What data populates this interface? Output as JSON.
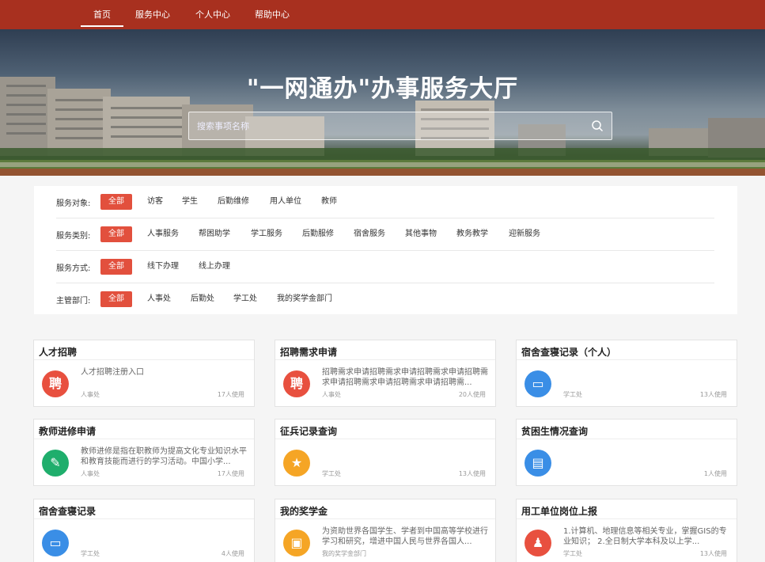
{
  "nav": [
    "首页",
    "服务中心",
    "个人中心",
    "帮助中心"
  ],
  "banner": {
    "title": "\"一网通办\"办事服务大厅",
    "search_placeholder": "搜索事项名称"
  },
  "filters": [
    {
      "label": "服务对象:",
      "options": [
        "全部",
        "访客",
        "学生",
        "后勤维修",
        "用人单位",
        "教师"
      ]
    },
    {
      "label": "服务类别:",
      "options": [
        "全部",
        "人事服务",
        "帮困助学",
        "学工服务",
        "后勤服修",
        "宿舍服务",
        "其他事物",
        "教务教学",
        "迎新服务"
      ]
    },
    {
      "label": "服务方式:",
      "options": [
        "全部",
        "线下办理",
        "线上办理"
      ]
    },
    {
      "label": "主管部门:",
      "options": [
        "全部",
        "人事处",
        "后勤处",
        "学工处",
        "我的奖学金部门"
      ]
    }
  ],
  "cards": [
    {
      "title": "人才招聘",
      "icon": "聘",
      "icon_name": "recruit-icon",
      "color": "red",
      "desc": "人才招聘注册入口",
      "dept": "人事处",
      "usage": "17人使用"
    },
    {
      "title": "招聘需求申请",
      "icon": "聘",
      "icon_name": "recruit-icon",
      "color": "red",
      "desc": "招聘需求申请招聘需求申请招聘需求申请招聘需求申请招聘需求申请招聘需求申请招聘需...",
      "dept": "人事处",
      "usage": "20人使用"
    },
    {
      "title": "宿舍查寝记录（个人）",
      "icon": "▭",
      "icon_name": "bed-icon",
      "color": "blue",
      "desc": "",
      "dept": "学工处",
      "usage": "13人使用"
    },
    {
      "title": "教师进修申请",
      "icon": "✎",
      "icon_name": "edit-icon",
      "color": "green",
      "desc": "教师进修是指在职教师为提高文化专业知识水平和教育技能而进行的学习活动。中国小学...",
      "dept": "人事处",
      "usage": "17人使用"
    },
    {
      "title": "征兵记录查询",
      "icon": "★",
      "icon_name": "military-icon",
      "color": "orange",
      "desc": "",
      "dept": "学工处",
      "usage": "13人使用"
    },
    {
      "title": "贫困生情况查询",
      "icon": "▤",
      "icon_name": "document-icon",
      "color": "blue",
      "desc": "",
      "dept": "",
      "usage": "1人使用"
    },
    {
      "title": "宿舍查寝记录",
      "icon": "▭",
      "icon_name": "bed-icon",
      "color": "blue",
      "desc": "",
      "dept": "学工处",
      "usage": "4人使用"
    },
    {
      "title": "我的奖学金",
      "icon": "▣",
      "icon_name": "scholarship-icon",
      "color": "orange",
      "desc": "为资助世界各国学生、学者到中国高等学校进行学习和研究，增进中国人民与世界各国人...",
      "dept": "我的奖学金部门",
      "usage": ""
    },
    {
      "title": "用工单位岗位上报",
      "icon": "♟",
      "icon_name": "tie-icon",
      "color": "red",
      "desc": "1.计算机、地理信息等相关专业，掌握GIS的专业知识； 2.全日制大学本科及以上学...",
      "dept": "学工处",
      "usage": "13人使用"
    }
  ]
}
